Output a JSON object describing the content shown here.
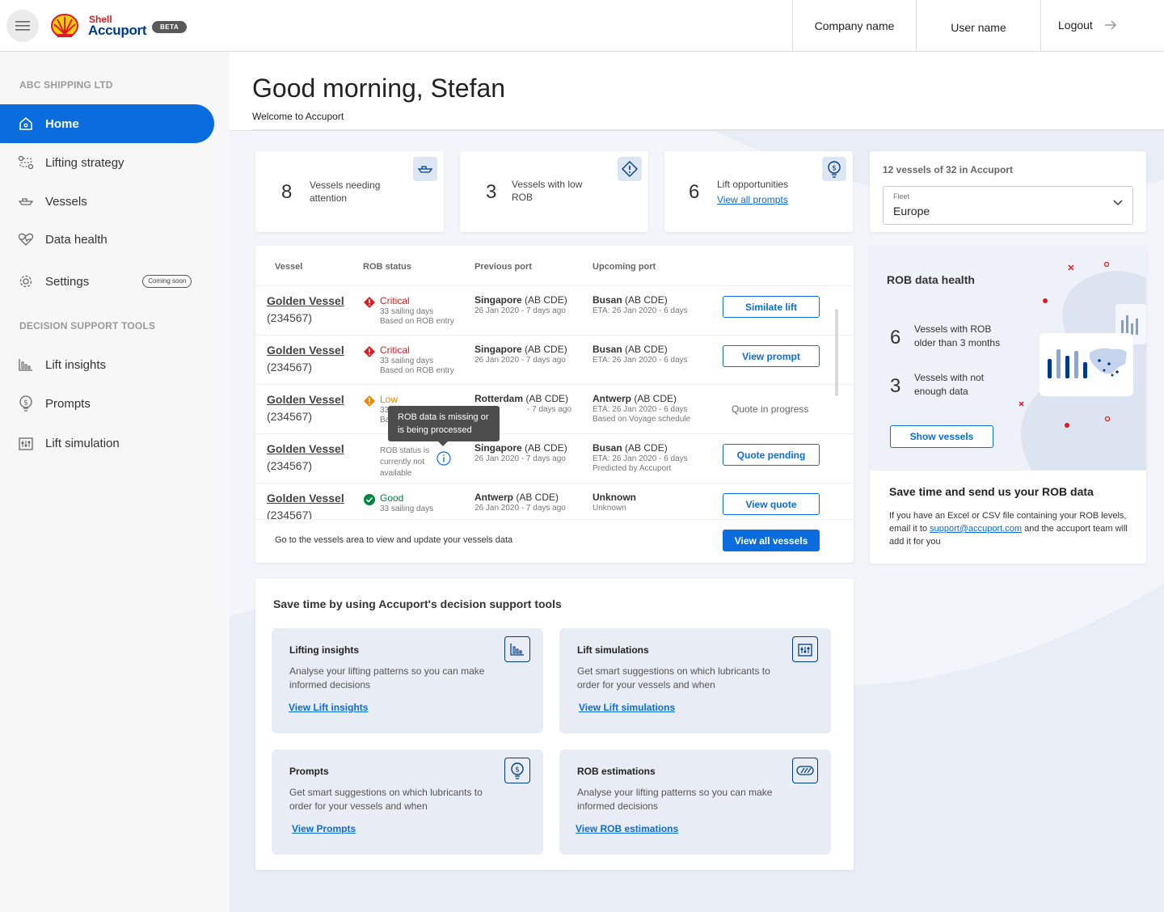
{
  "header": {
    "brand_top": "Shell",
    "brand_name": "Accuport",
    "beta": "BETA",
    "company": "Company name",
    "user": "User name",
    "logout": "Logout"
  },
  "sidebar": {
    "section1": "ABC SHIPPING LTD",
    "section2": "DECISION SUPPORT TOOLS",
    "items": [
      {
        "label": "Home",
        "icon": "home-icon"
      },
      {
        "label": "Lifting strategy",
        "icon": "route-icon"
      },
      {
        "label": "Vessels",
        "icon": "ship-icon"
      },
      {
        "label": "Data health",
        "icon": "heart-pulse-icon"
      },
      {
        "label": "Settings",
        "icon": "gear-icon",
        "badge": "Coming soon"
      },
      {
        "label": "Lift insights",
        "icon": "bar-chart-icon"
      },
      {
        "label": "Prompts",
        "icon": "lightbulb-dollar-icon"
      },
      {
        "label": "Lift simulation",
        "icon": "sliders-icon"
      }
    ]
  },
  "greeting": {
    "title": "Good morning, Stefan",
    "subtitle": "Welcome to Accuport"
  },
  "stats": [
    {
      "number": "8",
      "label": "Vessels needing attention",
      "icon": "ship-icon"
    },
    {
      "number": "3",
      "label": "Vessels with low ROB",
      "icon": "warning-diamond-icon"
    },
    {
      "number": "6",
      "label": "Lift opportunities",
      "link": "View all prompts",
      "icon": "lightbulb-dollar-icon"
    }
  ],
  "fleet": {
    "summary": "12 vessels of 32 in Accuport",
    "label": "Fleet",
    "value": "Europe"
  },
  "table": {
    "headers": [
      "Vessel",
      "ROB status",
      "Previous port",
      "Upcoming port"
    ],
    "rows": [
      {
        "name": "Golden Vessel",
        "id": "(234567)",
        "status": "Critical",
        "status_color": "#dd1d21",
        "s1": "33 sailing days",
        "s2": "Based on ROB entry",
        "prev_port": "Singapore",
        "prev_code": " (AB CDE)",
        "prev_date": "26 Jan 2020 - 7 days ago",
        "next_port": "Busan",
        "next_code": " (AB CDE)",
        "next_eta": "ETA: 26 Jan 2020 - 6 days",
        "next_note": "",
        "action": "Similate lift"
      },
      {
        "name": "Golden Vessel",
        "id": "(234567)",
        "status": "Critical",
        "status_color": "#dd1d21",
        "s1": "33 sailing days",
        "s2": "Based on ROB entry",
        "prev_port": "Singapore",
        "prev_code": " (AB CDE)",
        "prev_date": "26 Jan 2020 - 7 days ago",
        "next_port": "Busan",
        "next_code": " (AB CDE)",
        "next_eta": "ETA: 26 Jan 2020 - 6 days",
        "next_note": "",
        "action": "View prompt"
      },
      {
        "name": "Golden Vessel",
        "id": "(234567)",
        "status": "Low",
        "status_color": "#eb8705",
        "s1": "33",
        "s2": "Ba",
        "prev_port": "Rotterdam",
        "prev_code": " (AB CDE)",
        "prev_date": "- 7 days ago",
        "next_port": "Antwerp",
        "next_code": " (AB CDE)",
        "next_eta": "ETA: 26 Jan 2020 - 6 days",
        "next_note": "Based on Voyage schedule",
        "action": "Quote in progress"
      },
      {
        "name": "Golden Vessel",
        "id": "(234567)",
        "status": "ROB status is currently not available",
        "status_color": "#777",
        "s1": "",
        "s2": "",
        "prev_port": "Singapore",
        "prev_code": " (AB CDE)",
        "prev_date": "26 Jan 2020 - 7 days ago",
        "next_port": "Busan",
        "next_code": " (AB CDE)",
        "next_eta": "ETA: 26 Jan 2020 - 6 days",
        "next_note": "Predicted by Accuport",
        "action": "Quote pending"
      },
      {
        "name": "Golden Vessel",
        "id": "(234567)",
        "status": "Good",
        "status_color": "#008443",
        "s1": "33 sailing days",
        "s2": "",
        "prev_port": "Antwerp",
        "prev_code": " (AB CDE)",
        "prev_date": "26 Jan 2020 - 7 days ago",
        "next_port": "Unknown",
        "next_code": "",
        "next_eta": "Unknown",
        "next_note": "",
        "action": "View quote"
      }
    ],
    "tooltip": "ROB data is missing or is being processed",
    "footer": "Go to the vessels area to view and update your vessels data",
    "view_all": "View all vessels"
  },
  "rob_health": {
    "title": "ROB  data health",
    "items": [
      {
        "number": "6",
        "label": "Vessels with ROB older than 3 months"
      },
      {
        "number": "3",
        "label": "Vessels with not enough data"
      }
    ],
    "button": "Show vessels",
    "save_title": "Save time and send us your ROB data",
    "desc_before": "If you have an Excel or CSV file containing your ROB levels, email it to ",
    "email": "support@accuport.com",
    "desc_after": " and the accuport team will add it for you"
  },
  "tools": {
    "title": "Save time by using Accuport's decision support tools",
    "items": [
      {
        "title": "Lifting insights",
        "desc": "Analyse your lifting patterns so you can make informed decisions",
        "link": "View Lift insights",
        "icon": "bar-chart-icon"
      },
      {
        "title": "Lift simulations",
        "desc": "Get smart suggestions on which lubricants to order for your vessels and when",
        "link": "View Lift simulations",
        "icon": "sliders-icon"
      },
      {
        "title": "Prompts",
        "desc": "Get smart suggestions on which lubricants to order for your vessels and when",
        "link": "View Prompts",
        "icon": "lightbulb-dollar-icon"
      },
      {
        "title": "ROB estimations",
        "desc": "Analyse your lifting patterns so you can make informed decisions",
        "link": "View ROB estimations",
        "icon": "gauge-pill-icon"
      }
    ]
  },
  "colors": {
    "primary": "#0a6cdd",
    "navy": "#003c88",
    "shell_red": "#dd1d21",
    "shell_yellow": "#fbce07",
    "critical": "#dd1d21",
    "low": "#eb8705",
    "good": "#008443"
  }
}
